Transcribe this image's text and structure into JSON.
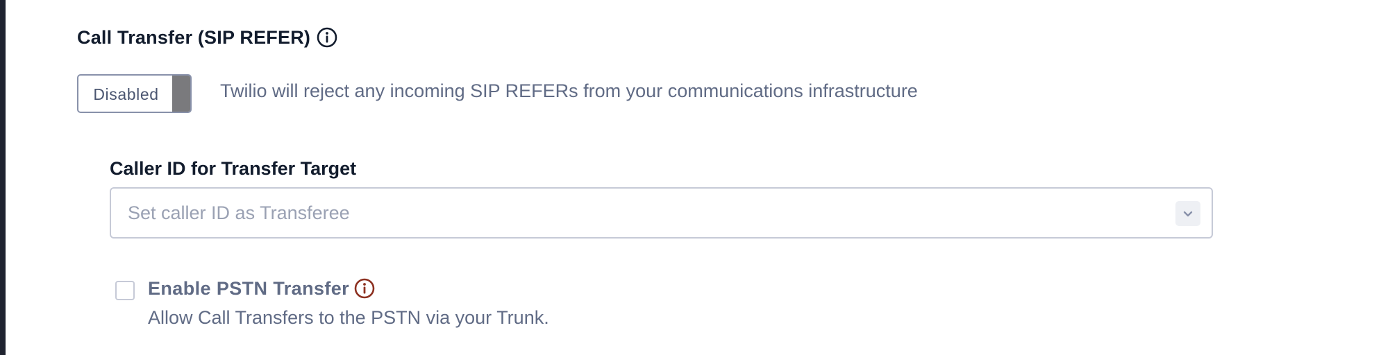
{
  "call_transfer": {
    "title": "Call Transfer (SIP REFER)",
    "title_icon": "info-icon",
    "toggle": {
      "label": "Disabled",
      "enabled": false,
      "description": "Twilio will reject any incoming SIP REFERs from your communications infrastructure"
    },
    "caller_id": {
      "label": "Caller ID for Transfer Target",
      "selected_value": "Set caller ID as Transferee",
      "icon": "chevron-down-icon"
    },
    "pstn_transfer": {
      "label": "Enable PSTN Transfer",
      "checked": false,
      "icon": "info-icon",
      "icon_color": "#8d3121",
      "help_text": "Allow Call Transfers to the PSTN via your Trunk."
    }
  },
  "colors": {
    "heading": "#121c2d",
    "body_text": "#606b85",
    "placeholder": "#9aa1b3",
    "border": "#c6cad7",
    "toggle_knob": "#7a7a7d"
  }
}
